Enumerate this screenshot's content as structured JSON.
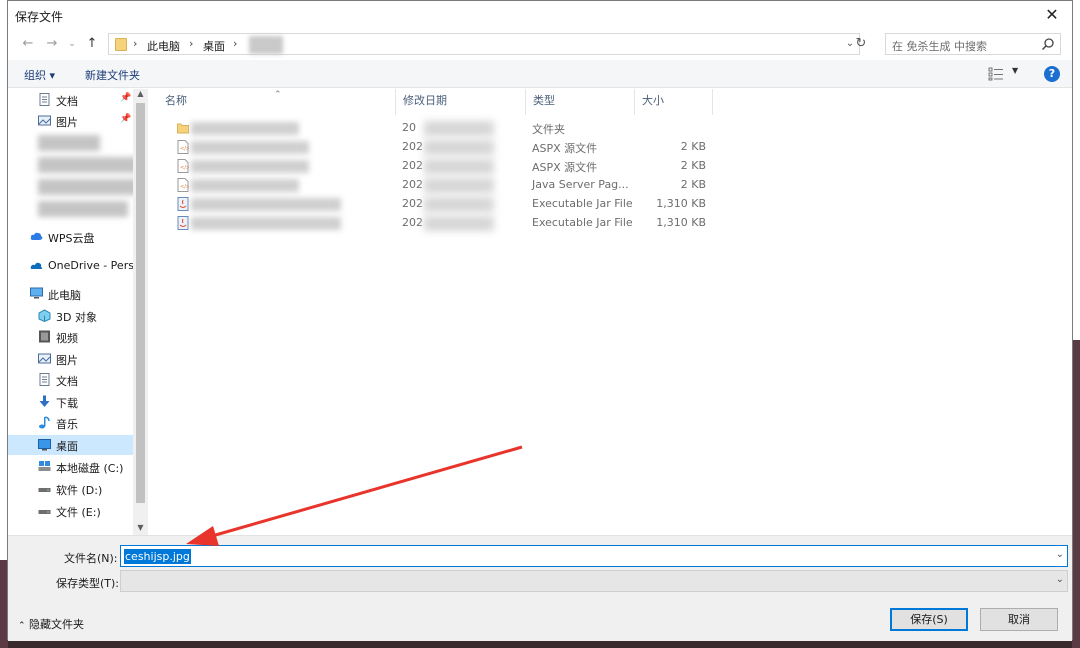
{
  "window": {
    "title": "保存文件"
  },
  "address": {
    "crumbs": [
      "此电脑",
      "桌面"
    ]
  },
  "search": {
    "placeholder": "在 免杀生成 中搜索"
  },
  "toolbar": {
    "organize": "组织 ▾",
    "new_folder": "新建文件夹"
  },
  "nav": {
    "quick": [
      {
        "label": "文档",
        "icon": "document-icon"
      },
      {
        "label": "图片",
        "icon": "pictures-icon"
      }
    ],
    "wps": "WPS云盘",
    "onedrive": "OneDrive - Perso",
    "this_pc": "此电脑",
    "pc_items": [
      {
        "label": "3D 对象",
        "icon": "3d-objects-icon"
      },
      {
        "label": "视频",
        "icon": "videos-icon"
      },
      {
        "label": "图片",
        "icon": "pictures-icon"
      },
      {
        "label": "文档",
        "icon": "document-icon"
      },
      {
        "label": "下载",
        "icon": "download-icon"
      },
      {
        "label": "音乐",
        "icon": "music-icon"
      },
      {
        "label": "桌面",
        "icon": "desktop-icon"
      },
      {
        "label": "本地磁盘 (C:)",
        "icon": "drive-c-icon"
      },
      {
        "label": "软件 (D:)",
        "icon": "drive-icon"
      },
      {
        "label": "文件 (E:)",
        "icon": "drive-icon"
      }
    ]
  },
  "columns": {
    "name": "名称",
    "date": "修改日期",
    "type": "类型",
    "size": "大小"
  },
  "files": [
    {
      "date": "20",
      "type": "文件夹",
      "size": "",
      "icon": "folder-icon"
    },
    {
      "date": "202",
      "type": "ASPX 源文件",
      "size": "2 KB",
      "icon": "aspx-file-icon"
    },
    {
      "date": "202",
      "type": "ASPX 源文件",
      "size": "2 KB",
      "icon": "aspx-file-icon"
    },
    {
      "date": "202",
      "type": "Java Server Pag...",
      "size": "2 KB",
      "icon": "jsp-file-icon"
    },
    {
      "date": "202",
      "type": "Executable Jar File",
      "size": "1,310 KB",
      "icon": "jar-file-icon"
    },
    {
      "date": "202",
      "type": "Executable Jar File",
      "size": "1,310 KB",
      "icon": "jar-file-icon"
    }
  ],
  "footer": {
    "filename_label": "文件名(N):",
    "filename_value": "ceshijsp.jpg",
    "filetype_label": "保存类型(T):",
    "hide_folders": "隐藏文件夹",
    "save": "保存(S)",
    "cancel": "取消"
  },
  "colors": {
    "accent": "#0078d7",
    "annotation_arrow": "#e8342a"
  }
}
